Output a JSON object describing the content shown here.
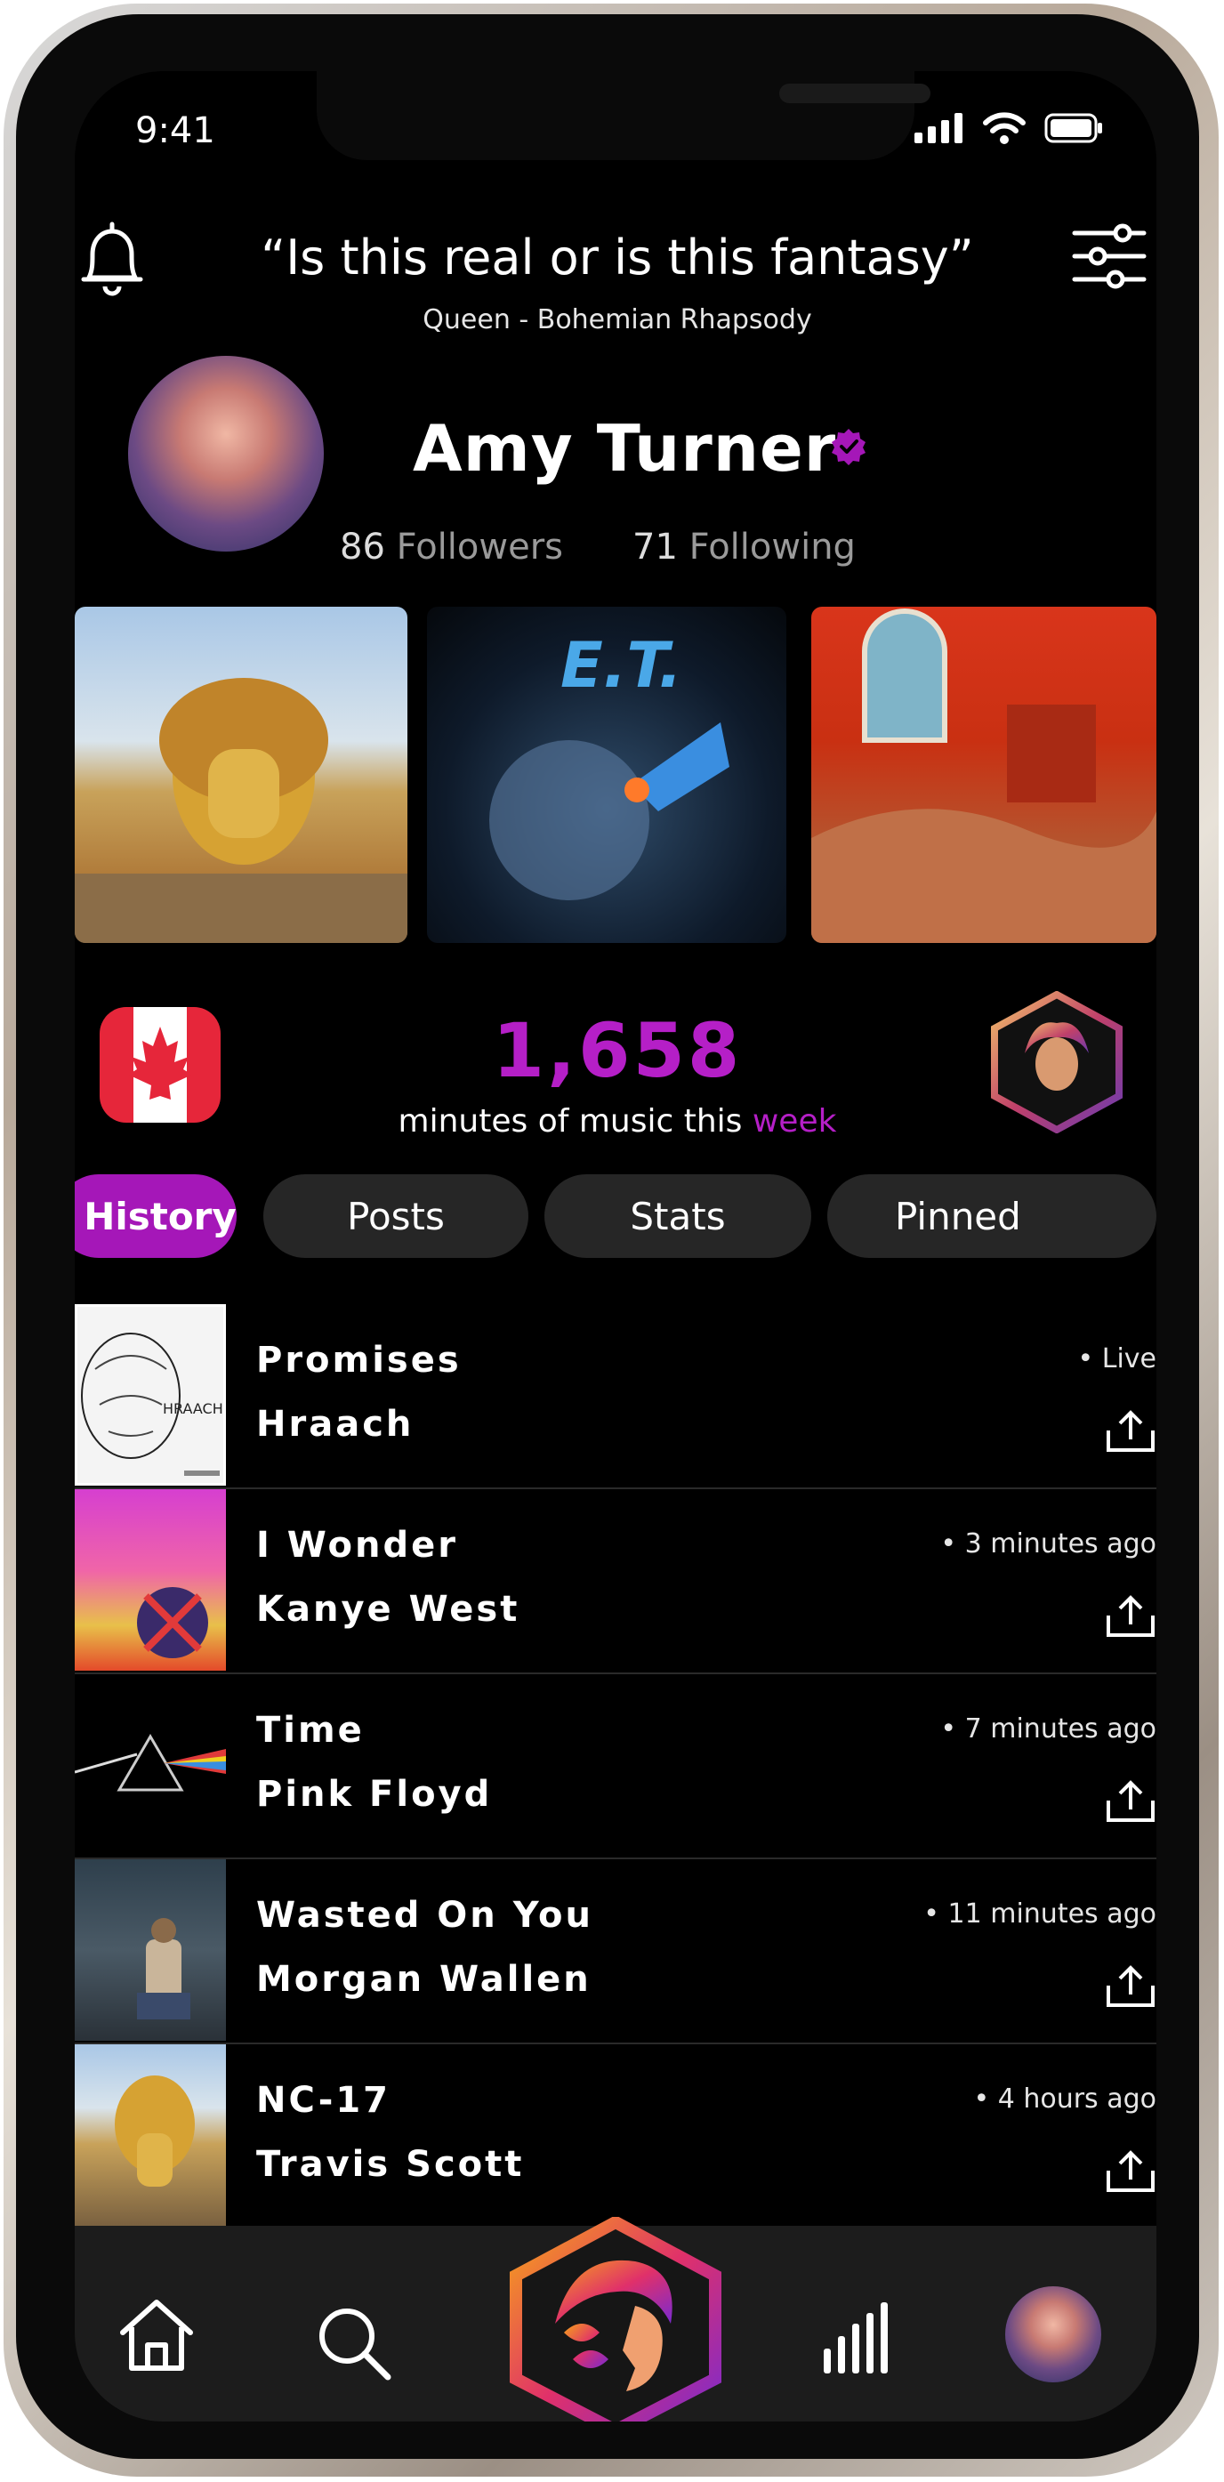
{
  "status_bar": {
    "time": "9:41"
  },
  "header": {
    "quote": "“Is this real or is this fantasy”",
    "quote_source": "Queen - Bohemian Rhapsody"
  },
  "profile": {
    "name": "Amy Turner",
    "followers_count": "86",
    "followers_label": "Followers",
    "following_count": "71",
    "following_label": "Following"
  },
  "stats": {
    "minutes": "1,658",
    "minutes_label_prefix": "minutes of music this ",
    "minutes_label_accent": "week"
  },
  "tabs": [
    {
      "label": "History",
      "active": true
    },
    {
      "label": "Posts",
      "active": false
    },
    {
      "label": "Stats",
      "active": false
    },
    {
      "label": "Pinned",
      "active": false
    }
  ],
  "history": [
    {
      "song": "Promises",
      "artist": "Hraach",
      "time": "• Live"
    },
    {
      "song": "I Wonder",
      "artist": "Kanye West",
      "time": "• 3 minutes ago"
    },
    {
      "song": "Time",
      "artist": "Pink Floyd",
      "time": "• 7 minutes ago"
    },
    {
      "song": "Wasted On You",
      "artist": "Morgan Wallen",
      "time": "• 11 minutes ago"
    },
    {
      "song": "NC-17",
      "artist": "Travis Scott",
      "time": "• 4 hours ago"
    }
  ],
  "colors": {
    "accent": "#a517b8",
    "background": "#000000",
    "tab_inactive": "#262626"
  },
  "icons": [
    "bell-icon",
    "filters-icon",
    "verified-icon",
    "canada-flag-icon",
    "medusa-logo-icon",
    "share-icon",
    "home-icon",
    "search-icon",
    "stats-icon"
  ]
}
